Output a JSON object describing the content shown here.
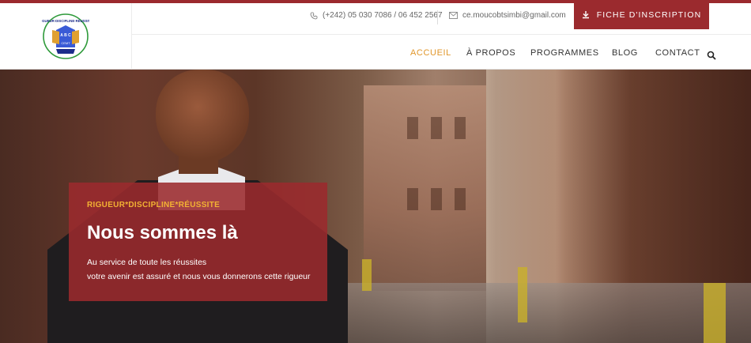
{
  "brand": {
    "logo_text": "RIGUEUR - DISCIPLINE - RÉUSSITE",
    "logo_initials": "A B C",
    "logo_sub": "CEMT"
  },
  "contact": {
    "phone": "(+242) 05 030 7086 / 06 452 2567",
    "email": "ce.moucobtsimbi@gmail.com",
    "cta_label": "FICHE D'INSCRIPTION"
  },
  "nav": {
    "items": [
      {
        "label": "ACCUEIL",
        "active": true
      },
      {
        "label": "À PROPOS",
        "active": false
      },
      {
        "label": "PROGRAMMES",
        "active": false
      },
      {
        "label": "BLOG",
        "active": false
      },
      {
        "label": "CONTACT",
        "active": false
      }
    ],
    "search_icon": "search-icon"
  },
  "hero": {
    "kicker": "RIGUEUR*DISCIPLINE*RÉUSSITE",
    "title": "Nous sommes là",
    "line1": "Au service de toute les réussites",
    "line2": "votre avenir est assuré et nous vous donnerons cette rigueur"
  },
  "colors": {
    "accent": "#9b2a2e",
    "nav_active": "#e0962a",
    "kicker": "#f2b233"
  }
}
